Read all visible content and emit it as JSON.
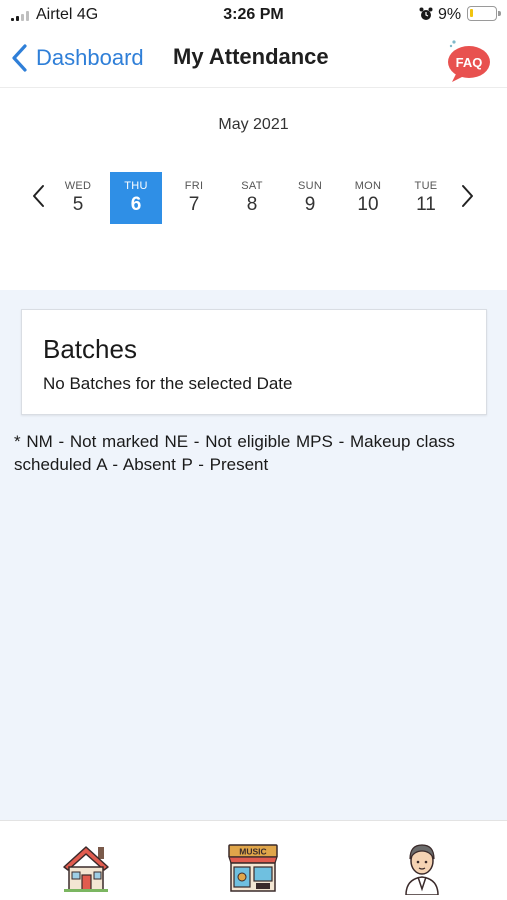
{
  "status_bar": {
    "carrier": "Airtel  4G",
    "time": "3:26 PM",
    "battery": "9%"
  },
  "header": {
    "back_label": "Dashboard",
    "title": "My Attendance",
    "faq_label": "FAQ"
  },
  "calendar": {
    "month": "May 2021",
    "days": [
      {
        "dow": "WED",
        "date": "5"
      },
      {
        "dow": "THU",
        "date": "6"
      },
      {
        "dow": "FRI",
        "date": "7"
      },
      {
        "dow": "SAT",
        "date": "8"
      },
      {
        "dow": "SUN",
        "date": "9"
      },
      {
        "dow": "MON",
        "date": "10"
      },
      {
        "dow": "TUE",
        "date": "11"
      }
    ]
  },
  "batches": {
    "title": "Batches",
    "message": "No Batches for the selected Date"
  },
  "legend": "* NM - Not marked   NE - Not eligible   MPS - Makeup class scheduled   A - Absent   P - Present",
  "tabs": {
    "music_sign": "MUSIC"
  },
  "colors": {
    "accent": "#2f8fe6",
    "link": "#2f7fd8",
    "content_bg": "#eff4fb"
  }
}
